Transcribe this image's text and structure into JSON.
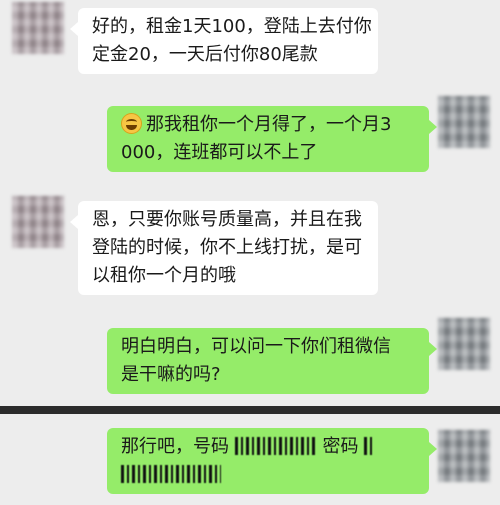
{
  "messages": [
    {
      "side": "left",
      "lines": [
        "好的，租金1天100，登陆上去付你",
        "定金20，一天后付你80尾款"
      ]
    },
    {
      "side": "right",
      "emoji": "laughing-emoji",
      "lines": [
        "那我租你一个月得了，一个月3",
        "000，连班都可以不上了"
      ]
    },
    {
      "side": "left",
      "lines": [
        "恩，只要你账号质量高，并且在我",
        "登陆的时候，你不上线打扰，是可",
        "以租你一个月的哦"
      ]
    },
    {
      "side": "right",
      "lines": [
        "明白明白，可以问一下你们租微信",
        "是干嘛的吗?"
      ]
    },
    {
      "side": "right",
      "lines_parts": {
        "prefix": "那行吧，号码",
        "middle": "密码"
      }
    }
  ],
  "colors": {
    "background": "#ededed",
    "incoming": "#ffffff",
    "outgoing": "#95ec69",
    "divider": "#2b2b2b"
  }
}
